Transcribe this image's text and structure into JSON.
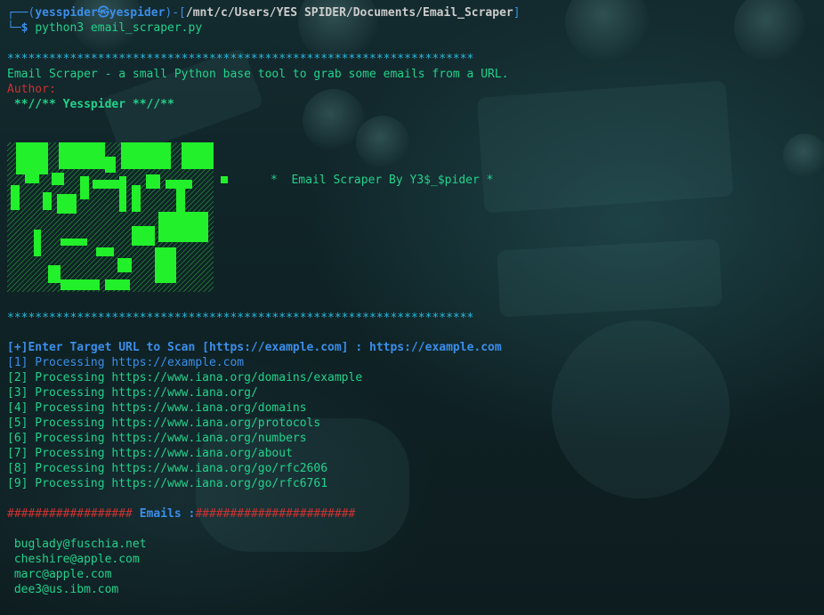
{
  "prompt": {
    "frame_top": "┌──(",
    "user": "yesspider",
    "at": "㉿",
    "host": "yespider",
    "path_open": ")-[",
    "path": "/mnt/c/Users/YES SPIDER/Documents/Email_Scraper",
    "path_close": "]",
    "frame_bottom": "└─",
    "dollar": "$",
    "command": "python3 email_scraper.py"
  },
  "banner": {
    "stars_line": "*******************************************************************",
    "description": "Email Scraper - a small Python base tool to grab some emails from a URL.",
    "author_label": "Author:",
    "author_name": " **//** Yesspider **//**",
    "tagline": "*  Email Scraper By Y3$_$pider *"
  },
  "scan": {
    "enter_prompt": "[+]Enter Target URL to Scan [https://example.com] : ",
    "entered_url": "https://example.com",
    "processing": [
      {
        "idx": "[1]",
        "text": " Processing https://example.com"
      },
      {
        "idx": "[2]",
        "text": " Processing https://www.iana.org/domains/example"
      },
      {
        "idx": "[3]",
        "text": " Processing https://www.iana.org/"
      },
      {
        "idx": "[4]",
        "text": " Processing https://www.iana.org/domains"
      },
      {
        "idx": "[5]",
        "text": " Processing https://www.iana.org/protocols"
      },
      {
        "idx": "[6]",
        "text": " Processing https://www.iana.org/numbers"
      },
      {
        "idx": "[7]",
        "text": " Processing https://www.iana.org/about"
      },
      {
        "idx": "[8]",
        "text": " Processing https://www.iana.org/go/rfc2606"
      },
      {
        "idx": "[9]",
        "text": " Processing https://www.iana.org/go/rfc6761"
      }
    ]
  },
  "emails_header": {
    "left_hashes": "################## ",
    "label": "Emails :",
    "right_hashes": "#######################"
  },
  "emails": [
    " buglady@fuschia.net",
    " cheshire@apple.com",
    " marc@apple.com",
    " dee3@us.ibm.com"
  ],
  "colors": {
    "blue": "#3b8eea",
    "green": "#23d18b",
    "bright_green": "#2bd63a",
    "red": "#cd3131",
    "white": "#cccccc"
  }
}
